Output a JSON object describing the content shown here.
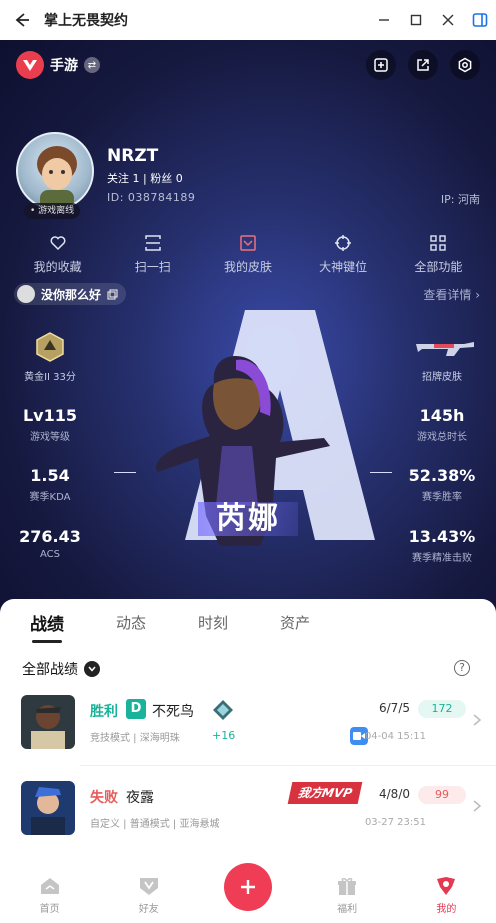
{
  "window": {
    "title": "掌上无畏契约"
  },
  "brand": {
    "name": "手游"
  },
  "profile": {
    "name": "NRZT",
    "follow": "关注 1   |   粉丝 0",
    "id": "ID:  038784189",
    "ip": "IP:  河南",
    "status": "• 游戏离线",
    "signature": "没你那么好"
  },
  "quick_actions": [
    {
      "label": "我的收藏",
      "icon": "heart-icon"
    },
    {
      "label": "扫一扫",
      "icon": "scan-icon"
    },
    {
      "label": "我的皮肤",
      "icon": "skin-icon"
    },
    {
      "label": "大神键位",
      "icon": "crosshair-icon"
    },
    {
      "label": "全部功能",
      "icon": "grid-icon"
    }
  ],
  "details_link": "查看详情",
  "rank": {
    "label": "黄金II 33分"
  },
  "skin": {
    "label": "招牌皮肤"
  },
  "stats_left": [
    {
      "value": "Lv115",
      "label": "游戏等级"
    },
    {
      "value": "1.54",
      "label": "赛季KDA"
    },
    {
      "value": "276.43",
      "label": "ACS"
    }
  ],
  "stats_right": [
    {
      "value": "145h",
      "label": "游戏总时长"
    },
    {
      "value": "52.38%",
      "label": "赛季胜率"
    },
    {
      "value": "13.43%",
      "label": "赛季精准击败"
    }
  ],
  "hero_agent": "芮娜",
  "tabs": [
    "战绩",
    "动态",
    "时刻",
    "资产"
  ],
  "record_filter": "全部战绩",
  "matches": [
    {
      "result": "胜利",
      "grade": "D",
      "agent": "不死鸟",
      "mode": "竞技模式 | 深海明珠",
      "rr_change": "+16",
      "kda": "6/7/5",
      "score": "172",
      "time": "04-04 15:11"
    },
    {
      "result": "失败",
      "agent": "夜露",
      "mvp": "我方MVP",
      "mode": "自定义 | 普通模式 | 亚海悬城",
      "kda": "4/8/0",
      "score": "99",
      "time": "03-27 23:51"
    }
  ],
  "bottom_nav": [
    {
      "label": "首页",
      "icon": "home-icon"
    },
    {
      "label": "好友",
      "icon": "friends-icon"
    },
    {
      "label": "",
      "icon": "plus-icon"
    },
    {
      "label": "福利",
      "icon": "gift-icon"
    },
    {
      "label": "我的",
      "icon": "profile-icon"
    }
  ],
  "colors": {
    "accent": "#ef3d55",
    "win": "#18b39a",
    "loss": "#e65b5b"
  }
}
